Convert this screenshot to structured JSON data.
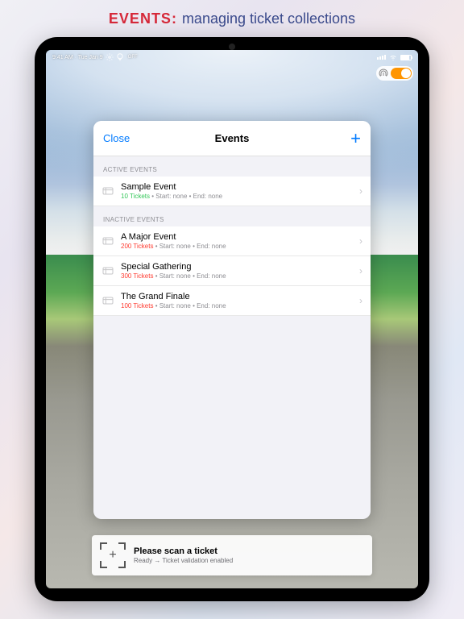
{
  "promo": {
    "accent": "EVENTS:",
    "text": "managing ticket collections"
  },
  "status": {
    "time": "9:41 AM · Tue Jan 9",
    "off": "OFF"
  },
  "modal": {
    "close": "Close",
    "title": "Events",
    "active_hdr": "ACTIVE EVENTS",
    "inactive_hdr": "INACTIVE EVENTS",
    "active": [
      {
        "title": "Sample Event",
        "tickets": "10 Tickets",
        "meta": " • Start: none • End: none"
      }
    ],
    "inactive": [
      {
        "title": "A Major Event",
        "tickets": "200 Tickets",
        "meta": " • Start: none • End: none"
      },
      {
        "title": "Special Gathering",
        "tickets": "300 Tickets",
        "meta": " • Start: none • End: none"
      },
      {
        "title": "The Grand Finale",
        "tickets": "100 Tickets",
        "meta": " • Start: none • End: none"
      }
    ]
  },
  "scan": {
    "title": "Please scan a ticket",
    "sub": "Ready → Ticket validation enabled"
  }
}
